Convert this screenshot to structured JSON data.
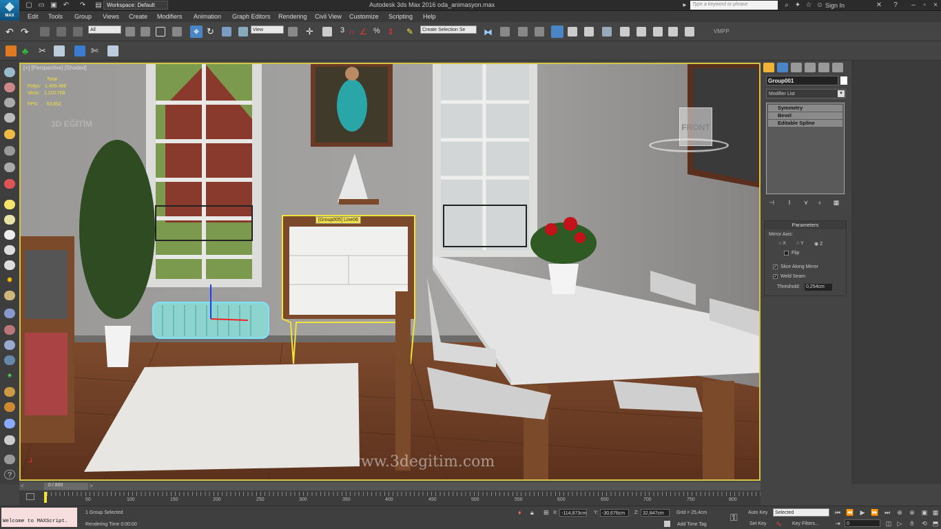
{
  "title_bar": {
    "workspace": "Workspace: Default",
    "app_title": "Autodesk 3ds Max 2016   oda_animasyon.max",
    "search_placeholder": "Type a keyword or phrase",
    "sign_in": "Sign In",
    "logo_text": "MAX"
  },
  "menu": [
    "Edit",
    "Tools",
    "Group",
    "Views",
    "Create",
    "Modifiers",
    "Animation",
    "Graph Editors",
    "Rendering",
    "Civil View",
    "Customize",
    "Scripting",
    "Help"
  ],
  "toolbar": {
    "selection_filter": "All",
    "ref_coord": "View",
    "named_selection": "Create Selection Se",
    "vmpp_label": "VMPP",
    "snap_label": "3"
  },
  "viewport": {
    "label": "[+] [Perspective] [Shaded]",
    "stats": {
      "total_label": "Total",
      "polys_label": "Polys:",
      "polys": "1.459.469",
      "verts_label": "Verts:",
      "verts": "1.110.768",
      "fps_label": "FPS:",
      "fps": "53,652"
    },
    "watermark_logo": "3D EĞİTİM",
    "tooltip": "[Group005] Line06",
    "viewcube": "FRONT",
    "watermark": "www.3degitim.com"
  },
  "command_panel": {
    "object_name": "Group001",
    "modifier_list": "Modifier List",
    "stack": [
      "Symmetry",
      "Bevel",
      "Editable Spline"
    ],
    "parameters": {
      "header": "Parameters",
      "mirror_axis": "Mirror Axis:",
      "axes": [
        "X",
        "Y",
        "Z"
      ],
      "selected_axis": "Z",
      "flip": "Flip",
      "slice": "Slice Along Mirror",
      "weld": "Weld Seam",
      "threshold_label": "Threshold:",
      "threshold": "0,254cm"
    }
  },
  "timeline": {
    "frame": "0 / 800",
    "ticks": [
      "50",
      "100",
      "150",
      "200",
      "250",
      "300",
      "350",
      "400",
      "450",
      "500",
      "550",
      "600",
      "650",
      "700",
      "750",
      "800"
    ]
  },
  "status": {
    "maxscript": "Welcome to MAXScript.",
    "selection": "1 Group Selected",
    "rendering_time": "Rendering Time  0:00:00",
    "x_label": "X:",
    "x": "-114,873cm",
    "y_label": "Y:",
    "y": "-30,676cm",
    "z_label": "Z:",
    "z": "32,847cm",
    "grid": "Grid = 25,4cm",
    "add_time_tag": "Add Time Tag",
    "auto_key": "Auto Key",
    "set_key": "Set Key",
    "selected_dd": "Selected",
    "key_filters": "Key Filters...",
    "frame_field": "0"
  },
  "colors": {
    "viewport_border": "#d6c447",
    "stats_text": "#f2e23c",
    "tooltip_bg": "#f6e04c",
    "selection_cyan": "#7fe3ff",
    "maxscript_bg": "#f6dede"
  }
}
